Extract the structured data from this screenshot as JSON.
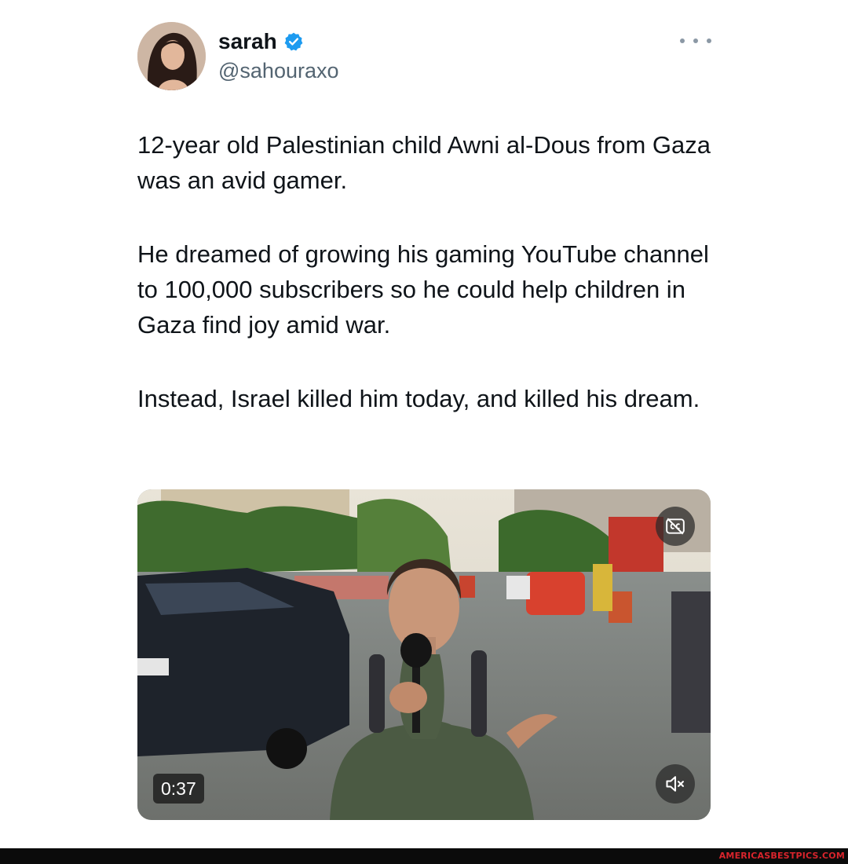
{
  "tweet": {
    "author": {
      "display_name": "sarah",
      "handle": "@sahouraxo",
      "verified": true,
      "verified_color": "#1d9bf0"
    },
    "more_icon": "more-horizontal-icon",
    "text": {
      "paragraph_1": "12-year old Palestinian child Awni al-Dous from Gaza was an avid gamer.",
      "paragraph_2": "He dreamed of growing his gaming YouTube channel to 100,000 subscribers so he could help children in Gaza find joy amid war.",
      "paragraph_3": "Instead, Israel killed him today, and killed his dream."
    },
    "media": {
      "type": "video",
      "duration": "0:37",
      "captions_icon": "closed-captions-icon",
      "mute_icon": "volume-muted-icon"
    }
  },
  "watermark": {
    "text": "AMERICASBESTPICS.COM",
    "color": "#d8242c"
  }
}
